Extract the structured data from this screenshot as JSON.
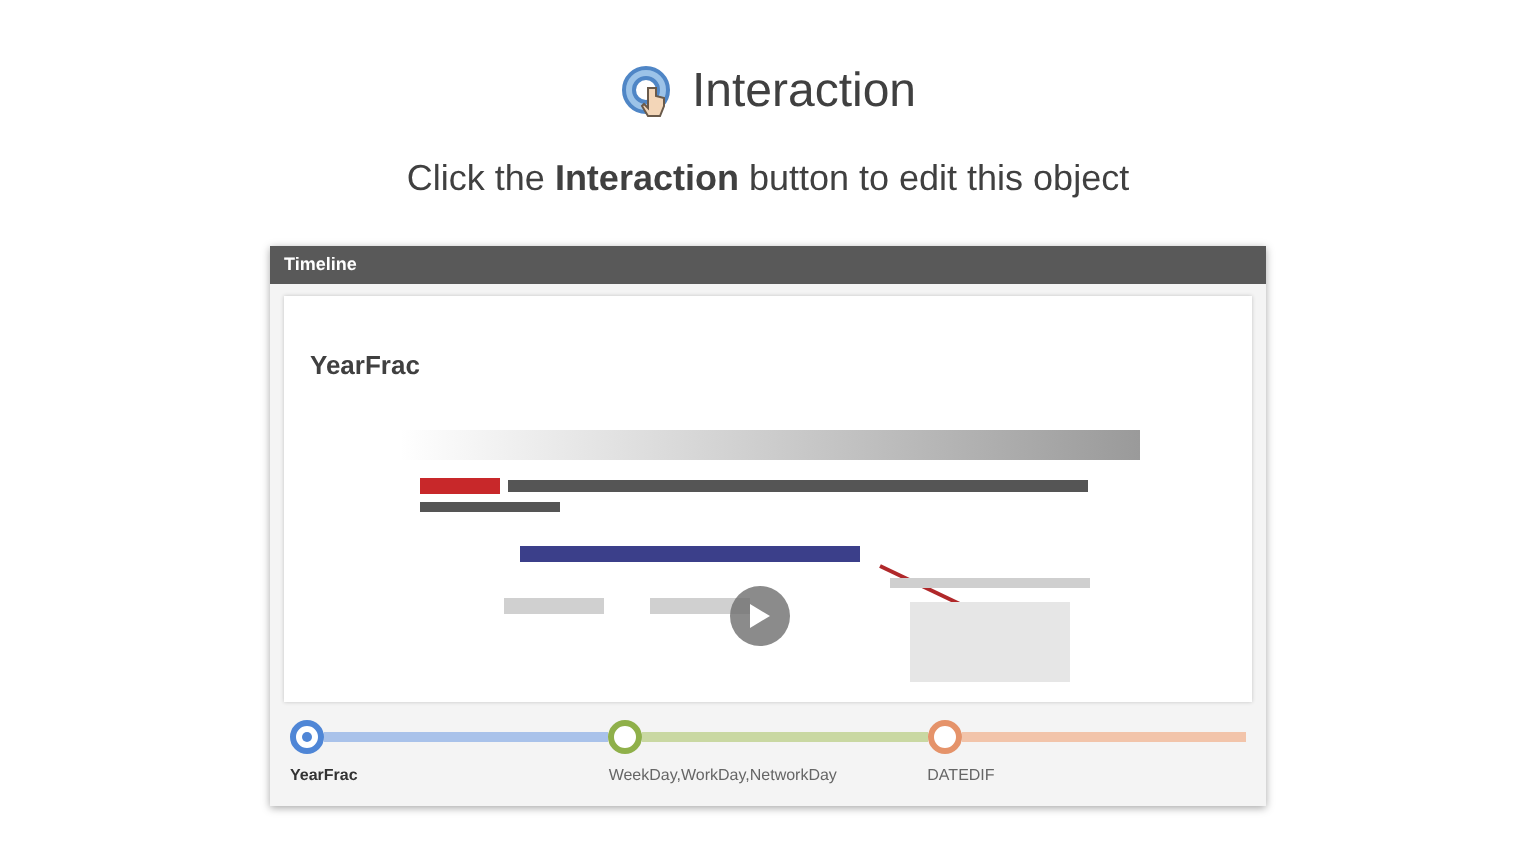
{
  "header": {
    "title": "Interaction",
    "instruction": "Click the **Interaction** button to edit this object"
  },
  "panel": {
    "title": "Timeline",
    "card": {
      "title": "YearFrac"
    },
    "timeline": [
      {
        "label": "YearFrac",
        "selected": true,
        "color": "#4f86d6"
      },
      {
        "label": "WeekDay,WorkDay,NetworkDay",
        "selected": false,
        "color": "#8fb04a"
      },
      {
        "label": "DATEDIF",
        "selected": false,
        "color": "#e5936a"
      }
    ]
  }
}
